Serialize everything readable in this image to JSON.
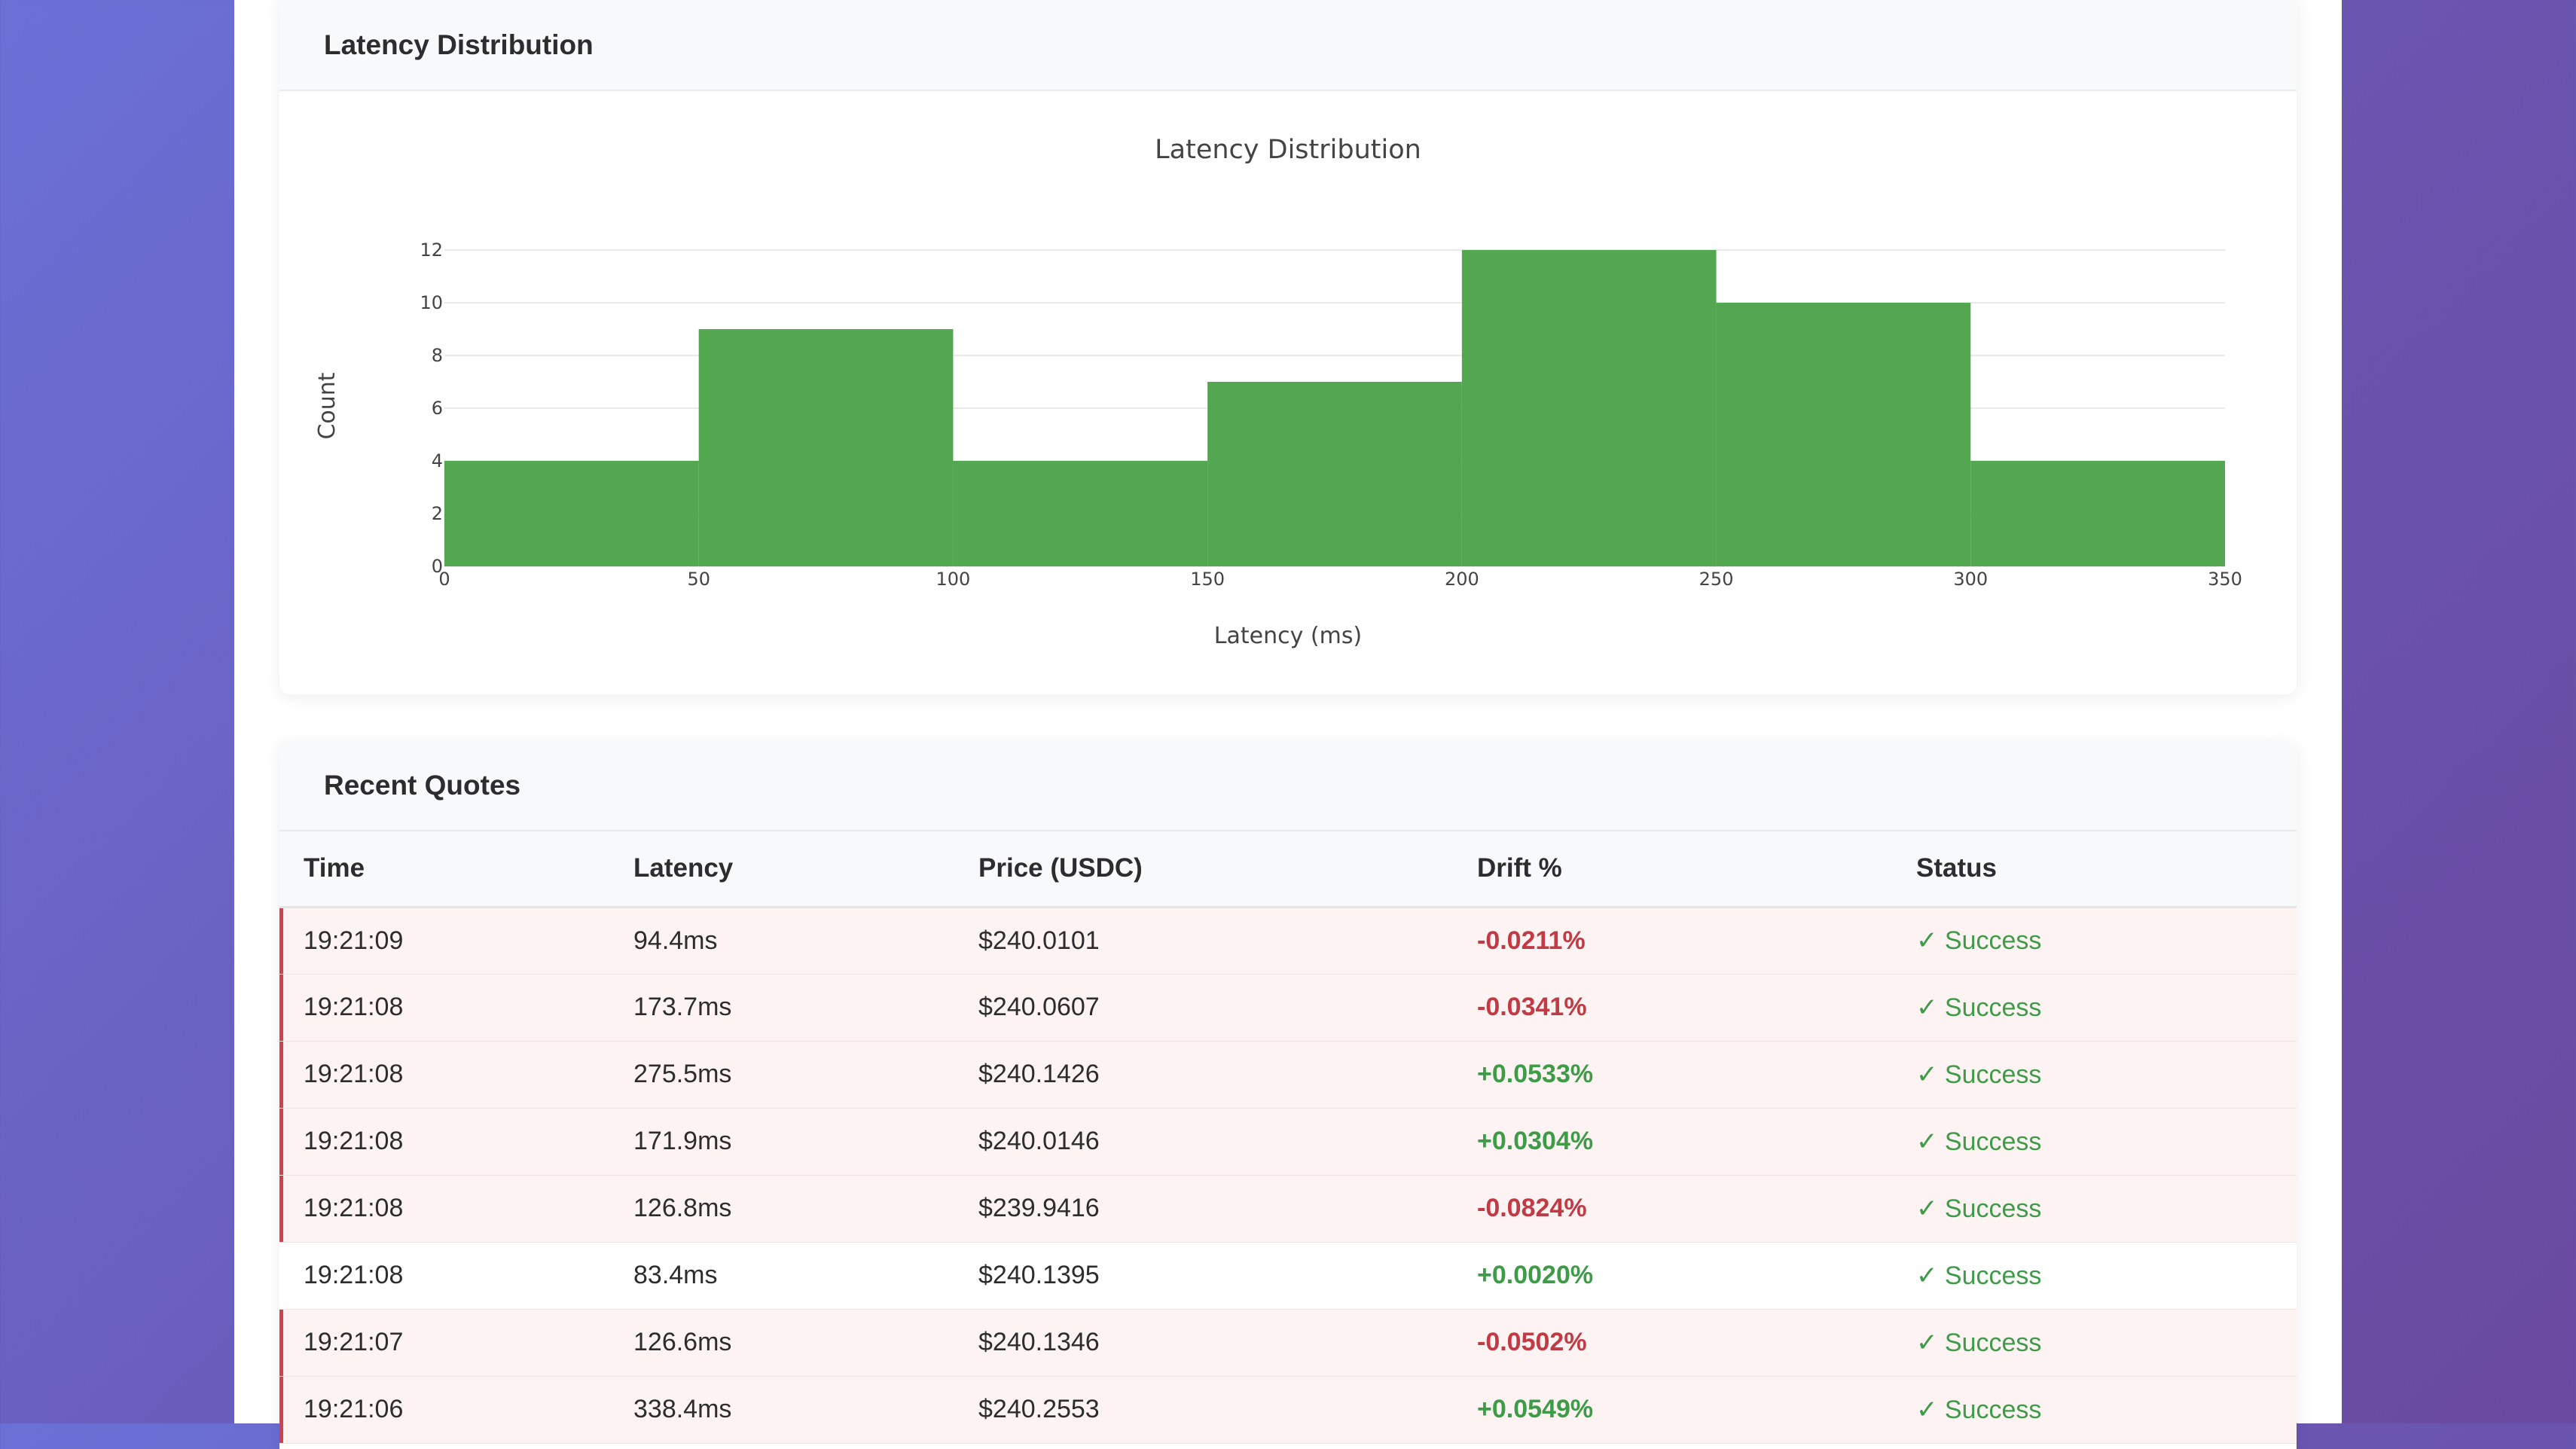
{
  "latency_card": {
    "title": "Latency Distribution"
  },
  "chart_data": {
    "type": "bar",
    "title": "Latency Distribution",
    "xlabel": "Latency (ms)",
    "ylabel": "Count",
    "bins": [
      [
        0,
        50
      ],
      [
        50,
        100
      ],
      [
        100,
        150
      ],
      [
        150,
        200
      ],
      [
        200,
        250
      ],
      [
        250,
        300
      ],
      [
        300,
        350
      ]
    ],
    "values": [
      4,
      9,
      4,
      7,
      12,
      10,
      4
    ],
    "xlim": [
      0,
      350
    ],
    "ylim": [
      0,
      12
    ],
    "x_ticks": [
      0,
      50,
      100,
      150,
      200,
      250,
      300,
      350
    ],
    "y_ticks": [
      0,
      2,
      4,
      6,
      8,
      10,
      12
    ],
    "bar_color": "#53a751",
    "grid": true
  },
  "quotes_card": {
    "title": "Recent Quotes",
    "columns": [
      "Time",
      "Latency",
      "Price (USDC)",
      "Drift %",
      "Status"
    ],
    "rows": [
      {
        "time": "19:21:09",
        "latency": "94.4ms",
        "price": "$240.0101",
        "drift": "-0.0211%",
        "status": "✓ Success",
        "alert": true
      },
      {
        "time": "19:21:08",
        "latency": "173.7ms",
        "price": "$240.0607",
        "drift": "-0.0341%",
        "status": "✓ Success",
        "alert": true
      },
      {
        "time": "19:21:08",
        "latency": "275.5ms",
        "price": "$240.1426",
        "drift": "+0.0533%",
        "status": "✓ Success",
        "alert": true
      },
      {
        "time": "19:21:08",
        "latency": "171.9ms",
        "price": "$240.0146",
        "drift": "+0.0304%",
        "status": "✓ Success",
        "alert": true
      },
      {
        "time": "19:21:08",
        "latency": "126.8ms",
        "price": "$239.9416",
        "drift": "-0.0824%",
        "status": "✓ Success",
        "alert": true
      },
      {
        "time": "19:21:08",
        "latency": "83.4ms",
        "price": "$240.1395",
        "drift": "+0.0020%",
        "status": "✓ Success",
        "alert": false
      },
      {
        "time": "19:21:07",
        "latency": "126.6ms",
        "price": "$240.1346",
        "drift": "-0.0502%",
        "status": "✓ Success",
        "alert": true
      },
      {
        "time": "19:21:06",
        "latency": "338.4ms",
        "price": "$240.2553",
        "drift": "+0.0549%",
        "status": "✓ Success",
        "alert": true
      }
    ]
  },
  "colors": {
    "negative": "#c13a44",
    "positive": "#3e9b48",
    "alert_row": "#fdf3f3",
    "alert_border": "#d0404d"
  }
}
